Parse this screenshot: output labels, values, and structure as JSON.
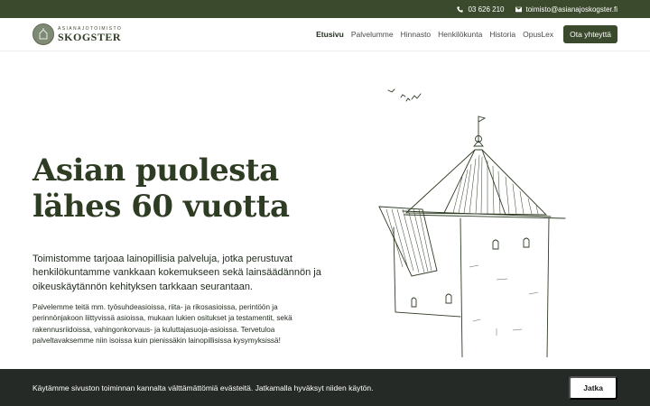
{
  "topbar": {
    "phone": "03 626 210",
    "email": "toimisto@asianajoskogster.fi"
  },
  "logo": {
    "small": "ASIANAJOTOIMISTO",
    "big": "SKOGSTER"
  },
  "nav": {
    "items": [
      "Etusivu",
      "Palvelumme",
      "Hinnasto",
      "Henkilökunta",
      "Historia",
      "OpusLex"
    ],
    "cta": "Ota yhteyttä"
  },
  "hero": {
    "title_line1": "Asian puolesta",
    "title_line2": "lähes 60 vuotta",
    "lead": "Toimistomme tarjoaa lainopillisia palveluja, jotka perustuvat henkilökuntamme vankkaan kokemukseen sekä lainsäädännön ja oikeuskäytännön kehityksen tarkkaan seurantaan.",
    "body": "Palvelemme teitä mm. työsuhdeasioissa, riita- ja rikosasioissa, perintöön ja perinnönjakoon liittyvissä asioissa, mukaan lukien ositukset ja testamentit, sekä rakennusriidoissa, vahingonkorvaus- ja kuluttajasuoja-asioissa. Tervetuloa palveltavaksemme niin isoissa kuin pienissäkin lainopillisissa kysymyksissä!"
  },
  "cookie": {
    "text": "Käytämme sivuston toiminnan kannalta välttämättömiä evästeitä. Jatkamalla hyväksyt niiden käytön.",
    "button": "Jatka"
  },
  "colors": {
    "brand": "#3b4a2c",
    "cookie_bg": "#262a26"
  },
  "icons": [
    "phone-icon",
    "mail-icon",
    "castle-illustration"
  ]
}
